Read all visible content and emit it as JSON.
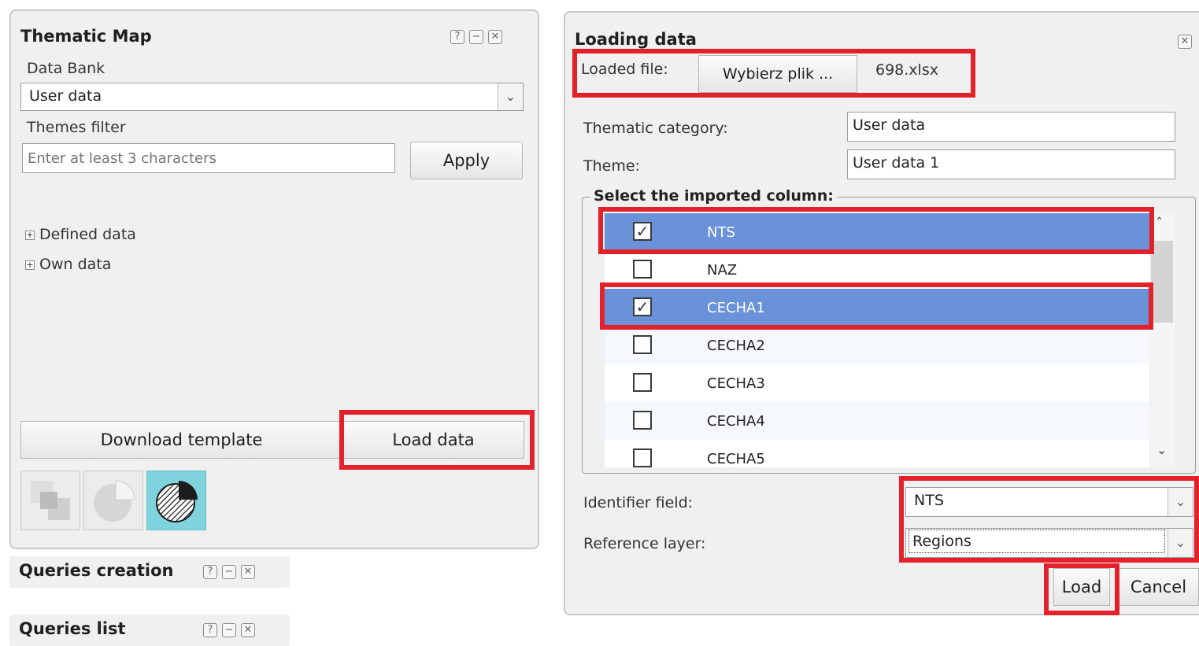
{
  "thematic_panel": {
    "title": "Thematic Map",
    "data_bank_label": "Data Bank",
    "data_bank_value": "User data",
    "themes_filter_label": "Themes filter",
    "themes_filter_placeholder": "Enter at least 3 characters",
    "apply_label": "Apply",
    "tree": [
      "Defined data",
      "Own data"
    ],
    "download_template_label": "Download template",
    "load_data_label": "Load data"
  },
  "queries_creation": {
    "title": "Queries creation"
  },
  "queries_list": {
    "title": "Queries list"
  },
  "win_controls": {
    "help": "?",
    "minimize": "−",
    "close": "✕"
  },
  "loading_dialog": {
    "title": "Loading data",
    "loaded_file_label": "Loaded file:",
    "choose_file_label": "Wybierz plik ...",
    "file_name": "698.xlsx",
    "thematic_category_label": "Thematic category:",
    "thematic_category_value": "User data",
    "theme_label": "Theme:",
    "theme_value": "User data 1",
    "select_columns_legend": "Select the imported column:",
    "columns": [
      {
        "name": "NTS",
        "checked": true
      },
      {
        "name": "NAZ",
        "checked": false
      },
      {
        "name": "CECHA1",
        "checked": true
      },
      {
        "name": "CECHA2",
        "checked": false
      },
      {
        "name": "CECHA3",
        "checked": false
      },
      {
        "name": "CECHA4",
        "checked": false
      },
      {
        "name": "CECHA5",
        "checked": false
      }
    ],
    "identifier_label": "Identifier field:",
    "identifier_value": "NTS",
    "reference_label": "Reference layer:",
    "reference_value": "Regions",
    "load_label": "Load",
    "cancel_label": "Cancel"
  },
  "colors": {
    "highlight": "#e3212b",
    "selected_row": "#6a92d8",
    "active_icon": "#7fd3dd"
  }
}
